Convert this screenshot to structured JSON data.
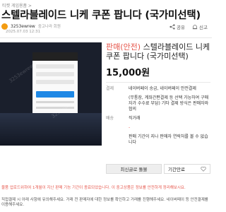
{
  "breadcrumb": "티켓 게임용품 >",
  "post": {
    "title": "스텔라블레이드 니케 쿠폰 팝니다 (국가미선택)",
    "user": "3253ewrew",
    "member_level": "중고나라 회원",
    "date": "2025.07.03 12:31"
  },
  "actions": {
    "share": "공유",
    "report": "신고"
  },
  "product": {
    "badge": "판매(안전)",
    "title": "스텔라블레이드 니케 쿠폰 팝니다 (국가미선택)",
    "price": "15,000원",
    "fields": [
      {
        "label": "결제",
        "value": "네이버페이 송금, 네이버페이 안전결제"
      },
      {
        "label": "",
        "value": "(무통장, 계좌간편결제 등 선택 가능하여 구매자가 수수료 부담) 기타 결제 방식은 판매자와 협의"
      },
      {
        "label": "배송",
        "value": "직거래"
      },
      {
        "label": "",
        "value": "-"
      },
      {
        "label": "",
        "value": "판매 기간이 지나 판매자 연락처를 볼 수 없습니다"
      }
    ]
  },
  "buttons": {
    "contact": "최신글로 돌볼",
    "wishlist": "기간만료"
  },
  "notice": "물품 업로드위하여 1개월이 지난 판매 기능 기간이 종료되었습니다. 이 중고상품은 정보를 안전하게 정리해보시요.",
  "body": "직접결제 시 아래 사항에 유의해주세요. 거래 전 판매자에 대한 정보를 확인하고 거래를 진행해주세요. 네이버페이 등 안전결제를 이용해주세요.",
  "colors": {
    "accent": "#e6564b",
    "dark": "#1a1f2c",
    "avatar": "#f39c12"
  }
}
